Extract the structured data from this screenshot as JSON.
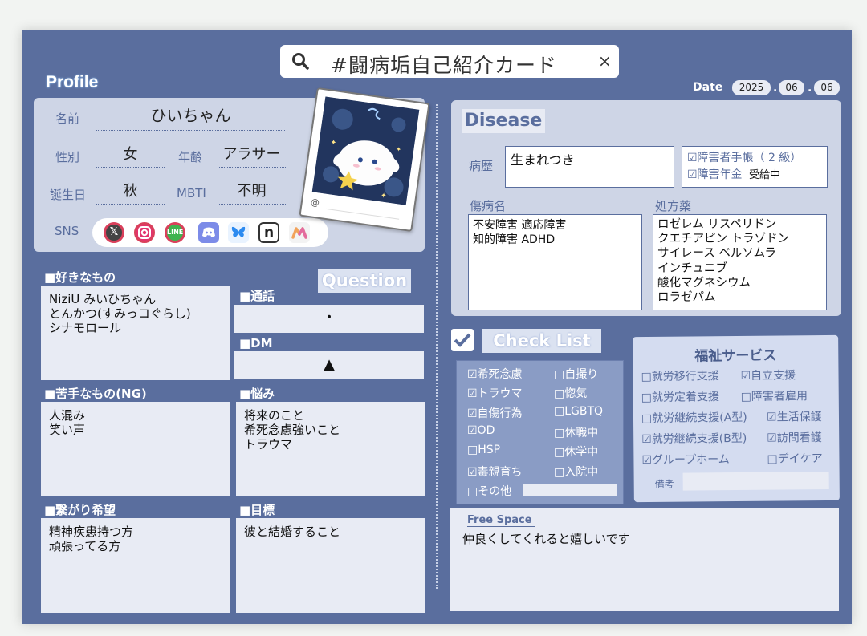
{
  "search": {
    "title": "#闘病垢自己紹介カード",
    "close": "×"
  },
  "date": {
    "label": "Date",
    "year": "2025",
    "month": "06",
    "day": "06"
  },
  "profile": {
    "heading": "Profile",
    "name_label": "名前",
    "name_value": "ひいちゃん",
    "gender_label": "性別",
    "gender_value": "女",
    "age_label": "年齢",
    "age_value": "アラサー",
    "birthday_label": "誕生日",
    "birthday_value": "秋",
    "mbti_label": "MBTI",
    "mbti_value": "不明",
    "sns_label": "SNS",
    "photo_caption": "@",
    "sns_icons": [
      "x-icon",
      "instagram-icon",
      "line-icon",
      "discord-icon",
      "bluesky-icon",
      "note-icon",
      "misskey-icon"
    ]
  },
  "question": {
    "heading": "Question"
  },
  "likes": {
    "label": "■好きなもの",
    "text": "NiziU みいひちゃん\nとんかつ(すみっコぐらし)\nシナモロール"
  },
  "call": {
    "label": "■通話",
    "value": "・"
  },
  "dm": {
    "label": "■DM",
    "value": "▲"
  },
  "dislikes": {
    "label": "■苦手なもの(NG)",
    "text": "人混み\n笑い声"
  },
  "worries": {
    "label": "■悩み",
    "text": "将来のこと\n希死念慮強いこと\nトラウマ"
  },
  "connect": {
    "label": "■繋がり希望",
    "text": "精神疾患持つ方\n頑張ってる方"
  },
  "goal": {
    "label": "■目標",
    "text": "彼と結婚すること"
  },
  "disease": {
    "heading": "Disease",
    "history_label": "病歴",
    "history_value": "生まれつき",
    "cert1": "☑障害者手帳（ 2 級）",
    "cert2_label": "☑障害年金",
    "cert2_status": "受給中",
    "diagnosis_label": "傷病名",
    "diagnosis_text": "不安障害 適応障害\n知的障害 ADHD",
    "meds_label": "処方薬",
    "meds_text": "ロゼレム リスペリドン\nクエチアピン トラゾドン\nサイレース ベルソムラ\nインチュニブ\n酸化マグネシウム\nロラゼパム"
  },
  "checklist": {
    "heading": "Check List",
    "col1": [
      "☑希死念慮",
      "☑トラウマ",
      "☑自傷行為",
      "☑OD",
      "□HSP",
      "☑毒親育ち",
      "□その他"
    ],
    "col2": [
      "□自撮り",
      "□惚気",
      "□LGBTQ",
      "□休職中",
      "□休学中",
      "□入院中"
    ]
  },
  "welfare": {
    "heading": "福祉サービス",
    "rows": [
      [
        "□就労移行支援",
        "☑自立支援"
      ],
      [
        "□就労定着支援",
        "□障害者雇用"
      ],
      [
        "□就労継続支援(A型)",
        "☑生活保護"
      ],
      [
        "☑就労継続支援(B型)",
        "☑訪問看護"
      ],
      [
        "☑グループホーム",
        "□デイケア"
      ]
    ],
    "note_label": "備考"
  },
  "free_space": {
    "label": "Free Space",
    "text": "仲良くしてくれると嬉しいです"
  },
  "colors": {
    "card": "#5a6e9e",
    "panel": "#ced5e6",
    "box": "#e8ebf4",
    "accent_label": "#5a6e9e"
  }
}
